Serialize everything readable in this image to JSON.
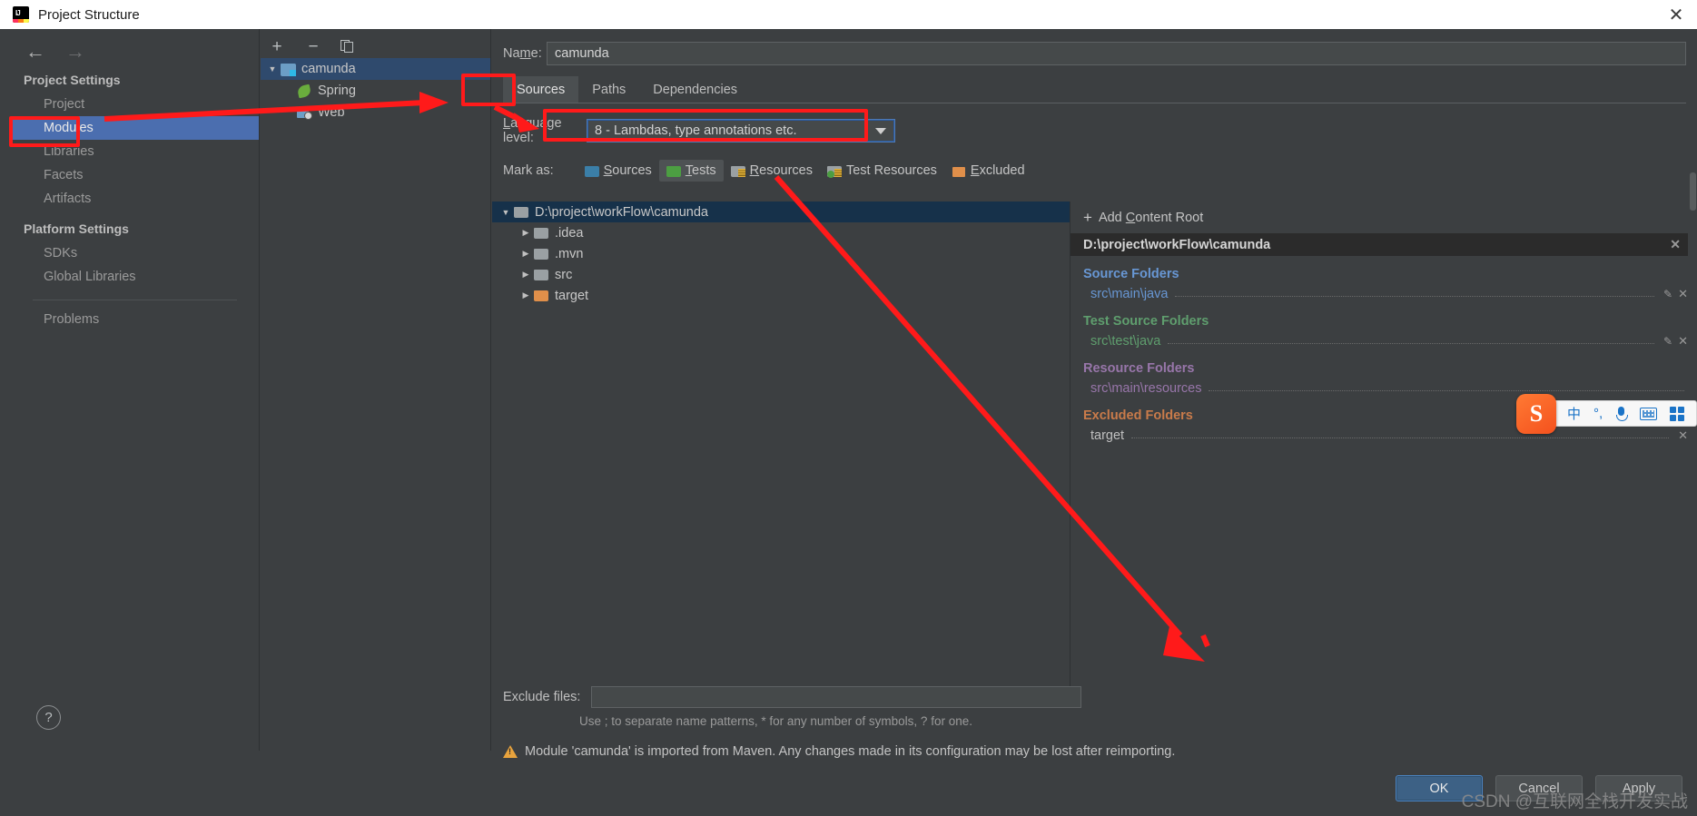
{
  "window": {
    "title": "Project Structure",
    "app_icon": "intellij-idea-icon",
    "close_label": "✕"
  },
  "sidebar": {
    "back_icon": "←",
    "forward_icon": "→",
    "groups": [
      {
        "header": "Project Settings",
        "items": [
          {
            "label": "Project",
            "selected": false
          },
          {
            "label": "Modules",
            "selected": true
          },
          {
            "label": "Libraries",
            "selected": false
          },
          {
            "label": "Facets",
            "selected": false
          },
          {
            "label": "Artifacts",
            "selected": false
          }
        ]
      },
      {
        "header": "Platform Settings",
        "items": [
          {
            "label": "SDKs",
            "selected": false
          },
          {
            "label": "Global Libraries",
            "selected": false
          }
        ]
      }
    ],
    "after_separator": [
      {
        "label": "Problems",
        "selected": false
      }
    ],
    "help_label": "?"
  },
  "module_tree": {
    "toolbar": {
      "add": "+",
      "remove": "−",
      "copy": "copy-icon"
    },
    "nodes": [
      {
        "label": "camunda",
        "icon": "module-folder-icon",
        "twisty": "▼",
        "selected": true,
        "depth": 0
      },
      {
        "label": "Spring",
        "icon": "spring-leaf-icon",
        "twisty": "",
        "selected": false,
        "depth": 1
      },
      {
        "label": "Web",
        "icon": "web-globe-icon",
        "twisty": "",
        "selected": false,
        "depth": 1
      }
    ]
  },
  "main": {
    "name_label": "Na",
    "name_label_mnemonic": "m",
    "name_label_rest": "e:",
    "name_value": "camunda",
    "tabs": [
      {
        "label": "Sources",
        "active": true
      },
      {
        "label": "Paths",
        "active": false
      },
      {
        "label": "Dependencies",
        "active": false
      }
    ],
    "language_level": {
      "label_mnemonic": "L",
      "label_rest": "anguage level:",
      "value": "8 - Lambdas, type annotations etc.",
      "caret_icon": "chevron-down-icon"
    },
    "mark_as": {
      "label": "Mark as:",
      "options": [
        {
          "label": "Sources",
          "mnemonic": "S",
          "rest": "ources",
          "color": "#3b7fa8",
          "kind": "plain",
          "active": false
        },
        {
          "label": "Tests",
          "mnemonic": "T",
          "rest": "ests",
          "color": "#4c9e42",
          "kind": "plain",
          "active": true
        },
        {
          "label": "Resources",
          "mnemonic": "R",
          "rest": "esources",
          "color": "#9aa0a3",
          "kind": "lines",
          "active": false
        },
        {
          "label": "Test Resources",
          "mnemonic": "",
          "rest": "Test Resources",
          "color": "#9aa0a3",
          "kind": "testres",
          "active": false
        },
        {
          "label": "Excluded",
          "mnemonic": "E",
          "rest": "xcluded",
          "color": "#e08f4a",
          "kind": "excluded",
          "active": false
        }
      ]
    },
    "content_roots": [
      {
        "label": "D:\\project\\workFlow\\camunda",
        "twisty": "▼",
        "depth": 0,
        "color": "#9aa0a3",
        "selected": true
      },
      {
        "label": ".idea",
        "twisty": "▶",
        "depth": 1,
        "color": "#9aa0a3",
        "selected": false
      },
      {
        "label": ".mvn",
        "twisty": "▶",
        "depth": 1,
        "color": "#9aa0a3",
        "selected": false
      },
      {
        "label": "src",
        "twisty": "▶",
        "depth": 1,
        "color": "#9aa0a3",
        "selected": false
      },
      {
        "label": "target",
        "twisty": "▶",
        "depth": 1,
        "color": "#e08f4a",
        "selected": false
      }
    ],
    "details": {
      "add_content_root": {
        "plus": "+",
        "prefix": "Add ",
        "mnemonic": "C",
        "rest": "ontent Root"
      },
      "root_path": "D:\\project\\workFlow\\camunda",
      "root_close_icon": "✕",
      "sections": [
        {
          "title": "Source Folders",
          "type": "src",
          "items": [
            {
              "path": "src\\main\\java",
              "edit_icon": "pencil-icon",
              "remove_icon": "✕"
            }
          ]
        },
        {
          "title": "Test Source Folders",
          "type": "test",
          "items": [
            {
              "path": "src\\test\\java",
              "edit_icon": "pencil-icon",
              "remove_icon": "✕"
            }
          ]
        },
        {
          "title": "Resource Folders",
          "type": "res",
          "items": [
            {
              "path": "src\\main\\resources",
              "edit_icon": "pencil-icon",
              "remove_icon": "✕"
            }
          ]
        },
        {
          "title": "Excluded Folders",
          "type": "exc",
          "items": [
            {
              "path": "target",
              "edit_icon": "",
              "remove_icon": "✕"
            }
          ]
        }
      ]
    },
    "exclude_files": {
      "label": "Exclude files:",
      "value": "",
      "hint": "Use ; to separate name patterns, * for any number of symbols, ? for one."
    },
    "warning": {
      "icon": "warning-triangle-icon",
      "text": "Module 'camunda' is imported from Maven. Any changes made in its configuration may be lost after reimporting."
    }
  },
  "buttons": [
    {
      "label": "OK",
      "mnemonic": "",
      "primary": true
    },
    {
      "label": "Cancel",
      "mnemonic": "",
      "primary": false
    },
    {
      "label": "Apply",
      "mnemonic": "A",
      "rest": "pply",
      "primary": false
    }
  ],
  "ime": {
    "logo": "S",
    "items": [
      {
        "icon": "chinese-mode-icon",
        "glyph": "中"
      },
      {
        "icon": "punctuation-icon",
        "glyph": "°,"
      },
      {
        "icon": "microphone-icon",
        "glyph": ""
      },
      {
        "icon": "keyboard-icon",
        "glyph": ""
      },
      {
        "icon": "apps-grid-icon",
        "glyph": ""
      }
    ]
  },
  "watermark": "CSDN @互联网全栈开发实战",
  "colors": {
    "accent_blue": "#4b6eaf",
    "selection_tree": "#2f4a6d",
    "src_blue": "#6897d4",
    "test_green": "#5f9e6e",
    "res_purple": "#9876aa",
    "exc_orange": "#c97b4a",
    "annotation_red": "#ff1a1a",
    "warning_amber": "#e8a33d"
  }
}
